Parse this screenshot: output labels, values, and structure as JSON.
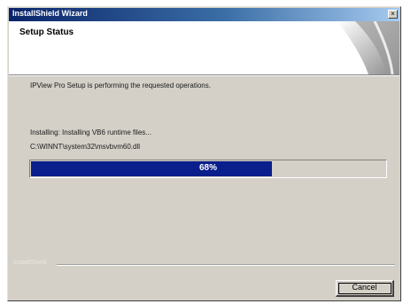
{
  "window": {
    "title": "InstallShield Wizard",
    "close_glyph": "×"
  },
  "header": {
    "heading": "Setup Status"
  },
  "body": {
    "message": "IPView Pro Setup is performing the requested operations.",
    "installing_text": "Installing: Installing VB6 runtime files...",
    "current_file": "C:\\WINNT\\system32\\msvbvm60.dll"
  },
  "progress": {
    "percent": 68,
    "label": "68%"
  },
  "footer": {
    "brand": "InstallShield",
    "cancel_label": "Cancel"
  },
  "colors": {
    "titlebar_start": "#0a246a",
    "progress_fill": "#0a1e8c",
    "dialog_bg": "#d4d0c8"
  }
}
